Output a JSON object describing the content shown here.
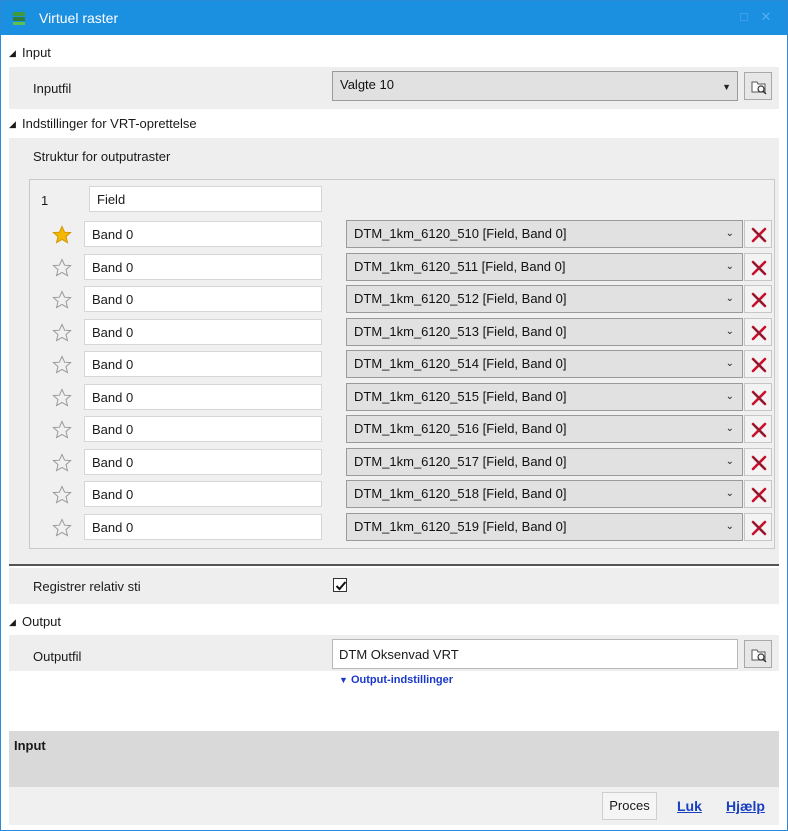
{
  "window": {
    "title": "Virtuel raster"
  },
  "input_section": {
    "header": "Input",
    "inputfil_label": "Inputfil",
    "inputfil_value": "Valgte  10"
  },
  "vrt_section": {
    "header": "Indstillinger for VRT-oprettelse",
    "struktur_label": "Struktur for outputraster",
    "field_index": "1",
    "field_name": "Field",
    "bands": [
      {
        "name": "Band 0",
        "source": "DTM_1km_6120_510 [Field, Band 0]",
        "starred": true
      },
      {
        "name": "Band 0",
        "source": "DTM_1km_6120_511 [Field, Band 0]",
        "starred": false
      },
      {
        "name": "Band 0",
        "source": "DTM_1km_6120_512 [Field, Band 0]",
        "starred": false
      },
      {
        "name": "Band 0",
        "source": "DTM_1km_6120_513 [Field, Band 0]",
        "starred": false
      },
      {
        "name": "Band 0",
        "source": "DTM_1km_6120_514 [Field, Band 0]",
        "starred": false
      },
      {
        "name": "Band 0",
        "source": "DTM_1km_6120_515 [Field, Band 0]",
        "starred": false
      },
      {
        "name": "Band 0",
        "source": "DTM_1km_6120_516 [Field, Band 0]",
        "starred": false
      },
      {
        "name": "Band 0",
        "source": "DTM_1km_6120_517 [Field, Band 0]",
        "starred": false
      },
      {
        "name": "Band 0",
        "source": "DTM_1km_6120_518 [Field, Band 0]",
        "starred": false
      },
      {
        "name": "Band 0",
        "source": "DTM_1km_6120_519 [Field, Band 0]",
        "starred": false
      }
    ],
    "registrer_label": "Registrer relativ sti",
    "registrer_checked": true
  },
  "output_section": {
    "header": "Output",
    "outputfil_label": "Outputfil",
    "outputfil_value": "DTM Oksenvad VRT",
    "settings_link": "Output-indstillinger"
  },
  "footer": {
    "info_header": "Input",
    "proces_label": "Proces",
    "luk_label": "Luk",
    "hjaelp_label": "Hjælp"
  },
  "colors": {
    "titlebar": "#1b8fe0",
    "link": "#1a38c8",
    "delete_red": "#c8102e",
    "star_gold": "#f5b800"
  }
}
